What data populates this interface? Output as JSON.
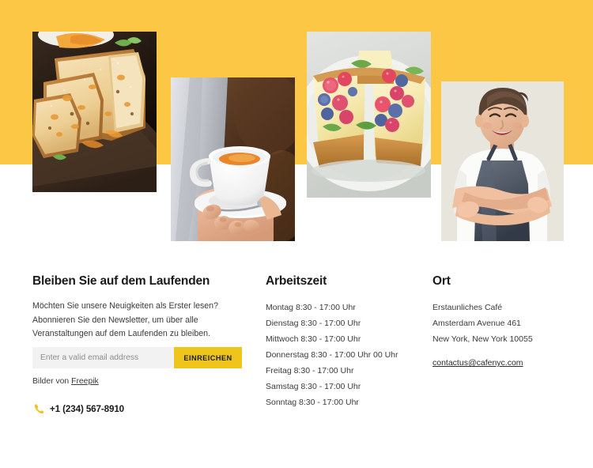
{
  "theme": {
    "band_yellow": "#fdc746",
    "button_yellow": "#efc51b",
    "input_gray": "#f2f2f2",
    "text_dark": "#1a1a1a",
    "text_body": "#3b3b3b"
  },
  "gallery": {
    "images": [
      {
        "name": "sliced-cake-loaf-photo",
        "alt": "Sliced fruit loaf cake on a dark wooden board"
      },
      {
        "name": "coffee-cup-photo",
        "alt": "Waiter holding a white cup of coffee on a saucer"
      },
      {
        "name": "berry-cheesecake-photo",
        "alt": "Slices of cheesecake topped with raspberries and blueberries"
      },
      {
        "name": "baker-portrait-photo",
        "alt": "Smiling woman baker in a grey apron with arms crossed"
      }
    ]
  },
  "newsletter": {
    "title": "Bleiben Sie auf dem Laufenden",
    "body_line1": "Möchten Sie unsere Neuigkeiten als Erster lesen?",
    "body_line2": "Abonnieren Sie den Newsletter, um über alle",
    "body_line3": "Veranstaltungen auf dem Laufenden zu bleiben.",
    "email_placeholder": "Enter a valid email address",
    "email_value": "",
    "submit_label": "EINREICHEN",
    "credit_prefix": "Bilder von ",
    "credit_link": "Freepik",
    "phone": "+1 (234) 567-8910",
    "phone_icon": "phone-handset-icon"
  },
  "hours": {
    "title": "Arbeitszeit",
    "items": [
      "Montag 8:30 - 17:00 Uhr",
      "Dienstag 8:30 - 17:00 Uhr",
      "Mittwoch 8:30 - 17:00 Uhr",
      "Donnerstag 8:30 - 17:00 Uhr 00 Uhr",
      "Freitag 8:30 - 17:00 Uhr",
      "Samstag 8:30 - 17:00 Uhr",
      "Sonntag 8:30 - 17:00 Uhr"
    ]
  },
  "location": {
    "title": "Ort",
    "line1": "Erstaunliches Café",
    "line2": "Amsterdam Avenue 461",
    "line3": "New York, New York 10055",
    "email": "contactus@cafenyc.com"
  }
}
